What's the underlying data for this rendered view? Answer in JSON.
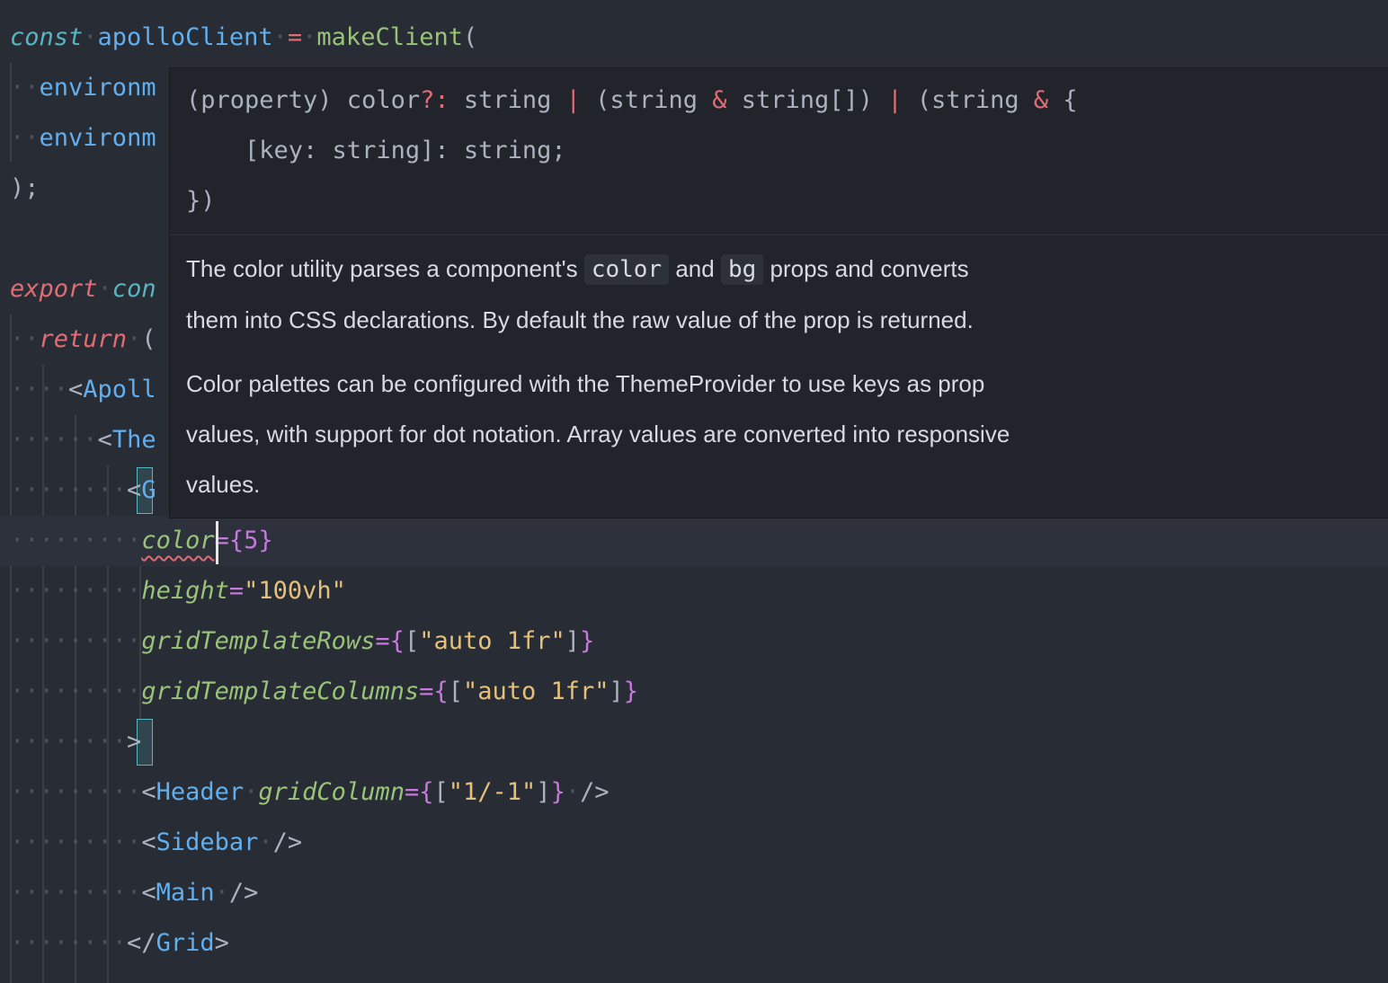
{
  "editor": {
    "lines": [
      {
        "const": "const",
        "name": "apolloClient",
        "eq": "=",
        "fn": "makeClient",
        "paren": "("
      },
      {
        "text": "environm"
      },
      {
        "text": "environm"
      },
      {
        "text": ");"
      },
      {
        "text": ""
      },
      {
        "export": "export",
        "con": "con"
      },
      {
        "return": "return",
        "paren": "("
      },
      {
        "lt": "<",
        "tag": "Apoll"
      },
      {
        "lt": "<",
        "tag": "The"
      },
      {
        "lt": "<",
        "tag": "G"
      },
      {
        "attr": "color",
        "eq": "=",
        "open": "{",
        "value": "5",
        "close": "}"
      },
      {
        "attr": "height",
        "eq": "=",
        "value": "\"100vh\""
      },
      {
        "attr": "gridTemplateRows",
        "eq": "=",
        "open": "{",
        "bopen": "[",
        "value": "\"auto 1fr\"",
        "bclose": "]",
        "close": "}"
      },
      {
        "attr": "gridTemplateColumns",
        "eq": "=",
        "open": "{",
        "bopen": "[",
        "value": "\"auto 1fr\"",
        "bclose": "]",
        "close": "}"
      },
      {
        "gt": ">"
      },
      {
        "lt": "<",
        "tag": "Header",
        "attr": "gridColumn",
        "eq": "=",
        "open": "{",
        "bopen": "[",
        "value": "\"1/-1\"",
        "bclose": "]",
        "close": "}",
        "selfclose": "/>"
      },
      {
        "lt": "<",
        "tag": "Sidebar",
        "selfclose": "/>"
      },
      {
        "lt": "<",
        "tag": "Main",
        "selfclose": "/>"
      },
      {
        "lt": "</",
        "tag": "Grid",
        "gt": ">"
      }
    ]
  },
  "tooltip": {
    "sig_prefix": "(property) color",
    "sig_optional": "?:",
    "sig_t1": " string ",
    "sig_pipe1": "|",
    "sig_t2a": " (string ",
    "sig_amp1": "&",
    "sig_t2b": " string[]) ",
    "sig_pipe2": "|",
    "sig_t3a": " (string ",
    "sig_amp2": "&",
    "sig_t3b": " {",
    "sig_line2": "    [key: string]: string;",
    "sig_line3": "})",
    "doc_p1_a": "The color utility parses a component's ",
    "doc_p1_code1": "color",
    "doc_p1_b": " and ",
    "doc_p1_code2": "bg",
    "doc_p1_c": " props and converts",
    "doc_p1_line2": "them into CSS declarations. By default the raw value of the prop is returned.",
    "doc_p2_line1": "Color palettes can be configured with the ThemeProvider to use keys as prop",
    "doc_p2_line2": "values, with support for dot notation. Array values are converted into responsive",
    "doc_p2_line3": "values."
  },
  "colors": {
    "background": "#282c34",
    "tooltip_bg": "#21252b",
    "error": "#e06c75",
    "keyword": "#56b6c2",
    "tag": "#61afef",
    "attribute": "#98c379",
    "string": "#e5c07b",
    "brace": "#c678dd"
  }
}
